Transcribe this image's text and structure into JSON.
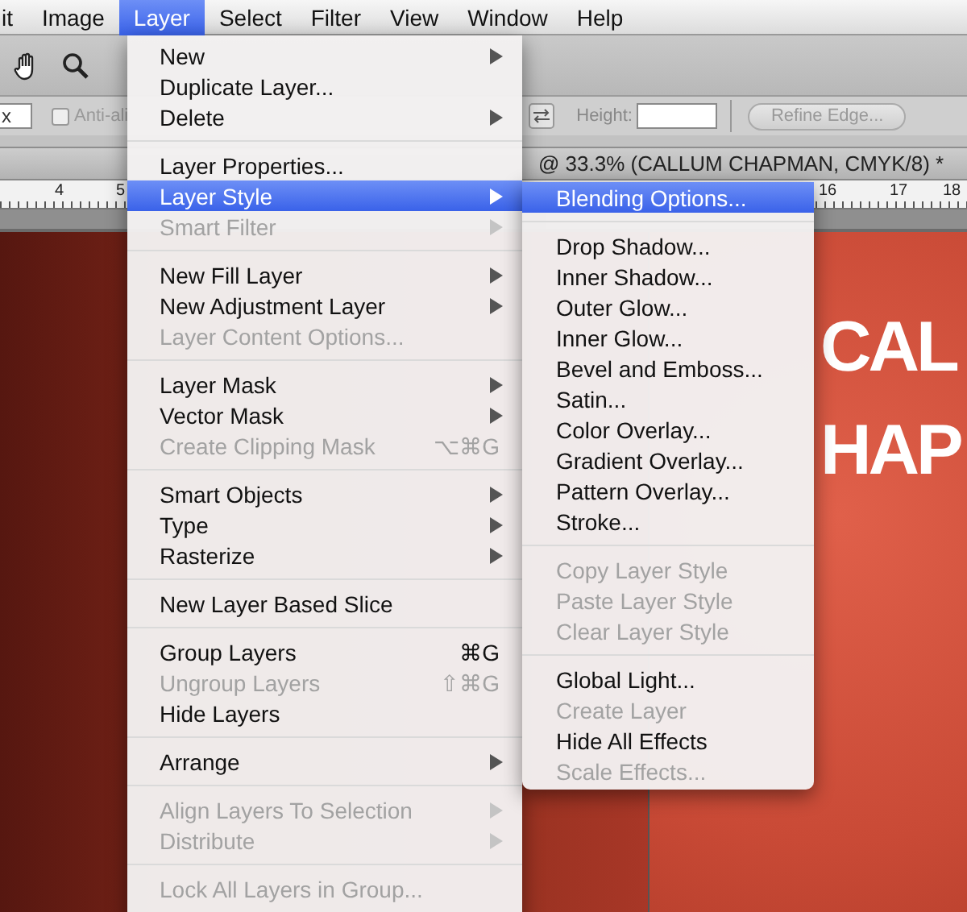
{
  "menu_bar": [
    {
      "label": "it",
      "selected": false
    },
    {
      "label": "Image",
      "selected": false
    },
    {
      "label": "Layer",
      "selected": true
    },
    {
      "label": "Select",
      "selected": false
    },
    {
      "label": "Filter",
      "selected": false
    },
    {
      "label": "View",
      "selected": false
    },
    {
      "label": "Window",
      "selected": false
    },
    {
      "label": "Help",
      "selected": false
    }
  ],
  "options_bar": {
    "size_field": {
      "value": "x"
    },
    "anti_alias": {
      "label": "Anti-ali",
      "checked": false
    },
    "height": {
      "label": "Height:"
    },
    "refine_edge": {
      "label": "Refine Edge...",
      "disabled": true
    }
  },
  "document_title": "@ 33.3% (CALLUM CHAPMAN, CMYK/8) *",
  "ruler": [
    "4",
    "5",
    "16",
    "17",
    "18"
  ],
  "canvas": {
    "texts": [
      "CAL",
      "HAP"
    ]
  },
  "layer_menu": {
    "groups": [
      [
        {
          "label": "New",
          "submenu": true,
          "disabled": false,
          "selected": false
        },
        {
          "label": "Duplicate Layer...",
          "submenu": false,
          "disabled": false,
          "selected": false
        },
        {
          "label": "Delete",
          "submenu": true,
          "disabled": false,
          "selected": false
        }
      ],
      [
        {
          "label": "Layer Properties...",
          "submenu": false,
          "disabled": false,
          "selected": false
        },
        {
          "label": "Layer Style",
          "submenu": true,
          "disabled": false,
          "selected": true
        },
        {
          "label": "Smart Filter",
          "submenu": true,
          "disabled": true,
          "selected": false
        }
      ],
      [
        {
          "label": "New Fill Layer",
          "submenu": true,
          "disabled": false,
          "selected": false
        },
        {
          "label": "New Adjustment Layer",
          "submenu": true,
          "disabled": false,
          "selected": false
        },
        {
          "label": "Layer Content Options...",
          "submenu": false,
          "disabled": true,
          "selected": false
        }
      ],
      [
        {
          "label": "Layer Mask",
          "submenu": true,
          "disabled": false,
          "selected": false
        },
        {
          "label": "Vector Mask",
          "submenu": true,
          "disabled": false,
          "selected": false
        },
        {
          "label": "Create Clipping Mask",
          "shortcut": "⌥⌘G",
          "submenu": false,
          "disabled": true,
          "selected": false
        }
      ],
      [
        {
          "label": "Smart Objects",
          "submenu": true,
          "disabled": false,
          "selected": false
        },
        {
          "label": "Type",
          "submenu": true,
          "disabled": false,
          "selected": false
        },
        {
          "label": "Rasterize",
          "submenu": true,
          "disabled": false,
          "selected": false
        }
      ],
      [
        {
          "label": "New Layer Based Slice",
          "submenu": false,
          "disabled": false,
          "selected": false
        }
      ],
      [
        {
          "label": "Group Layers",
          "shortcut": "⌘G",
          "submenu": false,
          "disabled": false,
          "selected": false
        },
        {
          "label": "Ungroup Layers",
          "shortcut": "⇧⌘G",
          "submenu": false,
          "disabled": true,
          "selected": false
        },
        {
          "label": "Hide Layers",
          "submenu": false,
          "disabled": false,
          "selected": false
        }
      ],
      [
        {
          "label": "Arrange",
          "submenu": true,
          "disabled": false,
          "selected": false
        }
      ],
      [
        {
          "label": "Align Layers To Selection",
          "submenu": true,
          "disabled": true,
          "selected": false
        },
        {
          "label": "Distribute",
          "submenu": true,
          "disabled": true,
          "selected": false
        }
      ],
      [
        {
          "label": "Lock All Layers in Group...",
          "submenu": false,
          "disabled": true,
          "selected": false
        }
      ]
    ]
  },
  "layer_style_submenu": {
    "groups": [
      [
        {
          "label": "Blending Options...",
          "disabled": false,
          "selected": true
        }
      ],
      [
        {
          "label": "Drop Shadow...",
          "disabled": false,
          "selected": false
        },
        {
          "label": "Inner Shadow...",
          "disabled": false,
          "selected": false
        },
        {
          "label": "Outer Glow...",
          "disabled": false,
          "selected": false
        },
        {
          "label": "Inner Glow...",
          "disabled": false,
          "selected": false
        },
        {
          "label": "Bevel and Emboss...",
          "disabled": false,
          "selected": false
        },
        {
          "label": "Satin...",
          "disabled": false,
          "selected": false
        },
        {
          "label": "Color Overlay...",
          "disabled": false,
          "selected": false
        },
        {
          "label": "Gradient Overlay...",
          "disabled": false,
          "selected": false
        },
        {
          "label": "Pattern Overlay...",
          "disabled": false,
          "selected": false
        },
        {
          "label": "Stroke...",
          "disabled": false,
          "selected": false
        }
      ],
      [
        {
          "label": "Copy Layer Style",
          "disabled": true,
          "selected": false
        },
        {
          "label": "Paste Layer Style",
          "disabled": true,
          "selected": false
        },
        {
          "label": "Clear Layer Style",
          "disabled": true,
          "selected": false
        }
      ],
      [
        {
          "label": "Global Light...",
          "disabled": false,
          "selected": false
        },
        {
          "label": "Create Layer",
          "disabled": true,
          "selected": false
        },
        {
          "label": "Hide All Effects",
          "disabled": false,
          "selected": false
        },
        {
          "label": "Scale Effects...",
          "disabled": true,
          "selected": false
        }
      ]
    ]
  }
}
